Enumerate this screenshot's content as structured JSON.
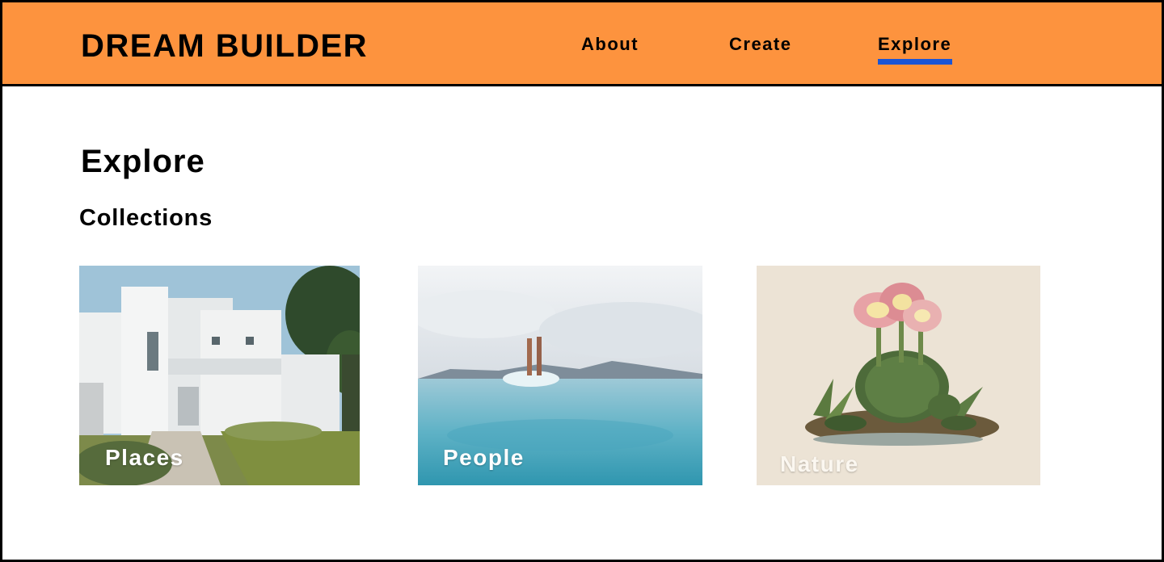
{
  "header": {
    "brand": "DREAM BUILDER",
    "nav": [
      {
        "label": "About"
      },
      {
        "label": "Create"
      },
      {
        "label": "Explore",
        "active": true
      }
    ],
    "background_color": "#fd933e",
    "active_underline_color": "#1a55d6"
  },
  "main": {
    "title": "Explore",
    "section_title": "Collections",
    "collections": [
      {
        "label": "Places",
        "image": "white-modern-house-photo"
      },
      {
        "label": "People",
        "image": "diver-legs-in-sea-photo"
      },
      {
        "label": "Nature",
        "image": "cactus-botanical-illustration"
      }
    ]
  }
}
